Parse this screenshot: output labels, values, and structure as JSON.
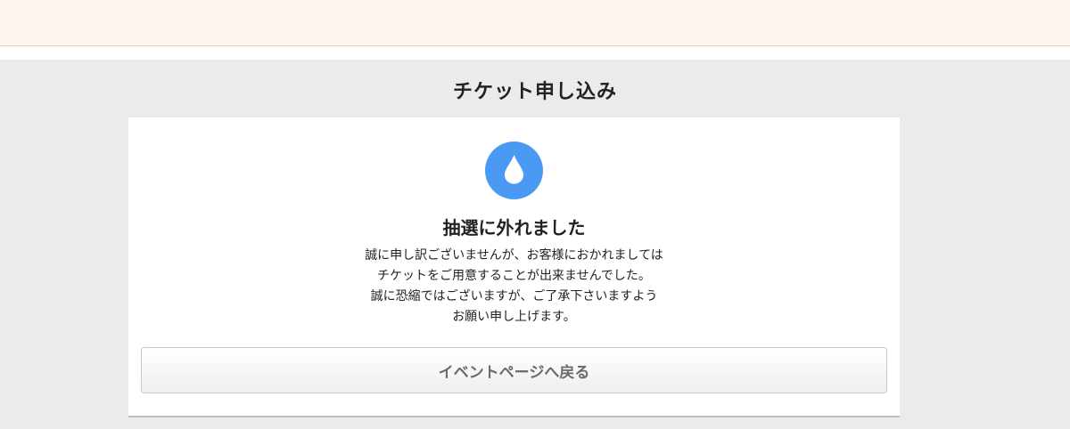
{
  "page": {
    "title": "チケット申し込み"
  },
  "result": {
    "icon": "water-drop-icon",
    "icon_color": "#4a9af4",
    "heading": "抽選に外れました",
    "message_lines": [
      "誠に申し訳ございませんが、お客様におかれましては",
      "チケットをご用意することが出来ませんでした。",
      "誠に恐縮ではございますが、ご了承下さいますよう",
      "お願い申し上げます。"
    ]
  },
  "actions": {
    "back_label": "イベントページへ戻る"
  }
}
